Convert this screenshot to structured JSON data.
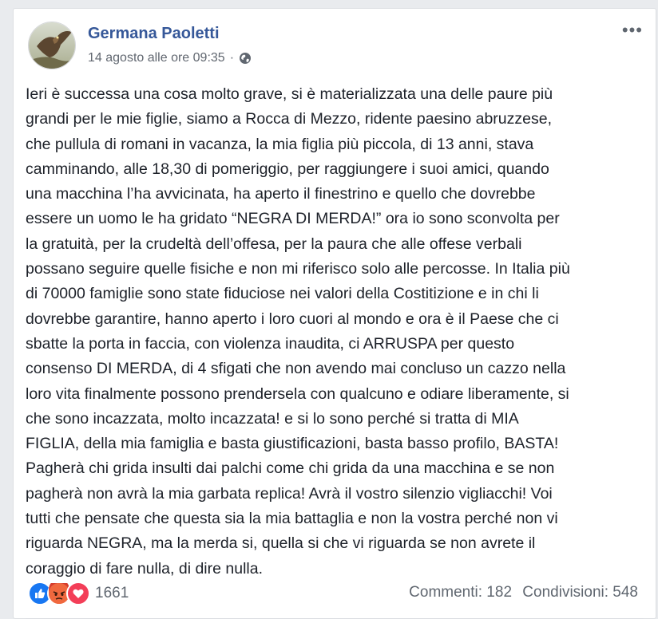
{
  "post": {
    "author": "Germana Paoletti",
    "timestamp": "14 agosto alle ore 09:35",
    "separator": "·",
    "privacy_icon": "globe-icon",
    "more_label": "•••",
    "body": "Ieri è successa una cosa molto grave, si è materializzata una delle paure più\ngrandi per le mie figlie, siamo a Rocca di Mezzo, ridente paesino abruzzese,\nche pullula di romani in vacanza, la mia figlia più piccola, di 13 anni, stava\ncamminando, alle 18,30 di pomeriggio, per raggiungere i suoi amici, quando\nuna macchina l’ha avvicinata, ha aperto il finestrino e quello che dovrebbe\nessere un uomo le ha gridato “NEGRA DI MERDA!” ora io sono sconvolta per\nla gratuità, per la crudeltà dell’offesa, per la paura che alle offese verbali\npossano seguire quelle fisiche e non mi riferisco solo alle percosse. In Italia più\ndi 70000 famiglie sono state fiduciose nei valori della Costitizione e in chi li\ndovrebbe garantire, hanno aperto i loro cuori al mondo e ora è il Paese che ci\nsbatte la porta in faccia, con violenza inaudita, ci ARRUSPA per questo\nconsenso DI MERDA, di 4 sfigati che non avendo mai concluso un cazzo nella\nloro vita finalmente possono prendersela con qualcuno e odiare liberamente, si\nche sono incazzata, molto incazzata! e si lo sono perché si tratta di MIA\nFIGLIA, della mia famiglia e basta giustificazioni, basta basso profilo, BASTA!\nPagherà chi grida insulti dai palchi come chi grida da una macchina e se non\npagherà non avrà la mia garbata replica! Avrà il vostro silenzio vigliacchi! Voi\ntutti che pensate che questa sia la mia battaglia e non la vostra perché non vi\nriguarda NEGRA, ma la merda si, quella si che vi riguarda se non avrete il\ncoraggio di fare nulla, di dire nulla."
  },
  "reactions": {
    "icons": [
      "like-icon",
      "angry-icon",
      "love-icon"
    ],
    "count": "1661"
  },
  "stats": {
    "comments": "Commenti: 182",
    "shares": "Condivisioni: 548"
  },
  "colors": {
    "author_link": "#365899",
    "meta_text": "#616770",
    "body_text": "#1d2129",
    "like": "#1877f2",
    "angry": "#f0683e",
    "love": "#f33e58"
  }
}
